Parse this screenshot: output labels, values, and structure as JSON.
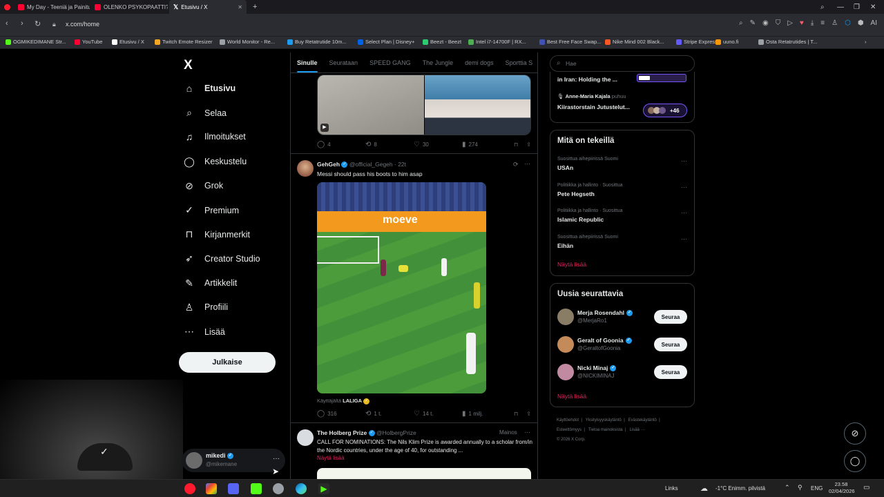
{
  "browser": {
    "tabs": [
      {
        "label": "My Day - Teeniä ja Painitu",
        "color": "#ff0033"
      },
      {
        "label": "OLENKO PSYKOPAATTI? Fr",
        "color": "#ff0033"
      },
      {
        "label": "Etusivu / X",
        "color": "#ffffff"
      }
    ],
    "new_tab": "+",
    "url": "x.com/home",
    "bookmarks": [
      {
        "label": "OGMIKEDIMANE Str...",
        "color": "#53fc18"
      },
      {
        "label": "YouTube",
        "color": "#ff0033"
      },
      {
        "label": "Etusivu / X",
        "color": "#ffffff"
      },
      {
        "label": "Twitch Emote Resizer",
        "color": "#f5a623"
      },
      {
        "label": "World Monitor - Re...",
        "color": "#9aa0a6"
      },
      {
        "label": "Buy Retatrutide 10m...",
        "color": "#1d9bf0"
      },
      {
        "label": "Select Plan | Disney+",
        "color": "#0063e5"
      },
      {
        "label": "Beezt - Beezt",
        "color": "#2ecc71"
      },
      {
        "label": "Intel i7-14700F | RX...",
        "color": "#4caf50"
      },
      {
        "label": "Best Free Face Swap...",
        "color": "#3f51b5"
      },
      {
        "label": "Nike Mind 002 Black...",
        "color": "#ff5722"
      },
      {
        "label": "Stripe Express",
        "color": "#635bff"
      },
      {
        "label": "uuno.fi",
        "color": "#ff9800"
      },
      {
        "label": "Osta Retatrutides | T...",
        "color": "#9aa0a6"
      }
    ]
  },
  "sidebar": {
    "logo": "X",
    "items": [
      {
        "label": "Etusivu",
        "icon": "home-icon",
        "glyph": "⌂"
      },
      {
        "label": "Selaa",
        "icon": "search-icon",
        "glyph": "⌕"
      },
      {
        "label": "Ilmoitukset",
        "icon": "bell-icon",
        "glyph": "♫"
      },
      {
        "label": "Keskustelu",
        "icon": "chat-icon",
        "glyph": "◯"
      },
      {
        "label": "Grok",
        "icon": "grok-icon",
        "glyph": "⊘"
      },
      {
        "label": "Premium",
        "icon": "premium-icon",
        "glyph": "✓"
      },
      {
        "label": "Kirjanmerkit",
        "icon": "bookmark-icon",
        "glyph": "⊓"
      },
      {
        "label": "Creator Studio",
        "icon": "rocket-icon",
        "glyph": "➶"
      },
      {
        "label": "Artikkelit",
        "icon": "article-icon",
        "glyph": "✎"
      },
      {
        "label": "Profiili",
        "icon": "profile-icon",
        "glyph": "♙"
      },
      {
        "label": "Lisää",
        "icon": "more-icon",
        "glyph": "⋯"
      }
    ],
    "post_button": "Julkaise",
    "account": {
      "name": "mikedi",
      "handle": "@mikemane",
      "menu": "···"
    }
  },
  "feed": {
    "tabs": [
      "Sinulle",
      "Seurataan",
      "SPEED GANG",
      "The Jungle",
      "demi dogs",
      "Sporttia S"
    ],
    "post1": {
      "replies": "4",
      "reposts": "8",
      "likes": "30",
      "views": "274"
    },
    "post2": {
      "name": "GehGeh",
      "handle": "@official_Gegeh",
      "time": "· 22t",
      "text": "Messi should pass his boots to him asap",
      "banner_text": "moeve",
      "attribution_prefix": "Käyttäjältä",
      "attribution_name": "LALIGA",
      "replies": "316",
      "reposts": "1 t.",
      "likes": "14 t.",
      "views": "1 milj."
    },
    "post3": {
      "name": "The Holberg Prize",
      "handle": "@HolbergPrize",
      "ad": "Mainos",
      "text": "CALL FOR NOMINATIONS: The Nils Klim Prize is awarded annually to a scholar from/in the Nordic countries, under the age of 40, for outstanding ...",
      "show_more": "Näytä lisää"
    }
  },
  "right": {
    "search_placeholder": "Hae",
    "spaces": [
      {
        "title": "in Iran: Holding the ...",
        "count": ""
      },
      {
        "host": "Anne-Maria Kajala",
        "verb": "puhuu",
        "title": "Kiirastorstain Jutustelut...",
        "count": "+46"
      }
    ],
    "trends": {
      "title": "Mitä on tekeillä",
      "items": [
        {
          "meta": "Suosittua aihepiirissä Suomi",
          "name": "USAn"
        },
        {
          "meta": "Politiikka ja hallinto · Suosittua",
          "name": "Pete Hegseth"
        },
        {
          "meta": "Politiikka ja hallinto · Suosittua",
          "name": "Islamic Republic"
        },
        {
          "meta": "Suosittua aihepiirissä Suomi",
          "name": "Eihän"
        }
      ],
      "show_more": "Näytä lisää"
    },
    "follow": {
      "title": "Uusia seurattavia",
      "button": "Seuraa",
      "users": [
        {
          "name": "Merja Rosendahl",
          "handle": "@MerjaRo1"
        },
        {
          "name": "Geralt of Goonia",
          "handle": "@GeraltofGoonia"
        },
        {
          "name": "Nicki Minaj",
          "handle": "@NICKIMINAJ"
        }
      ],
      "show_more": "Näytä lisää"
    },
    "footer": {
      "line1": [
        "Käyttöehdot",
        "Yksityisyyskäytäntö",
        "Evästekäytäntö"
      ],
      "line2": [
        "Esteettömyys",
        "Tietoa mainoksista",
        "Lisää ···"
      ],
      "copyright": "© 2026 X Corp."
    }
  },
  "taskbar": {
    "links": "Links",
    "weather": "-1°C  Enimm. pilvistä",
    "lang": "ENG",
    "time": "23.58",
    "date": "02/04/2026"
  }
}
